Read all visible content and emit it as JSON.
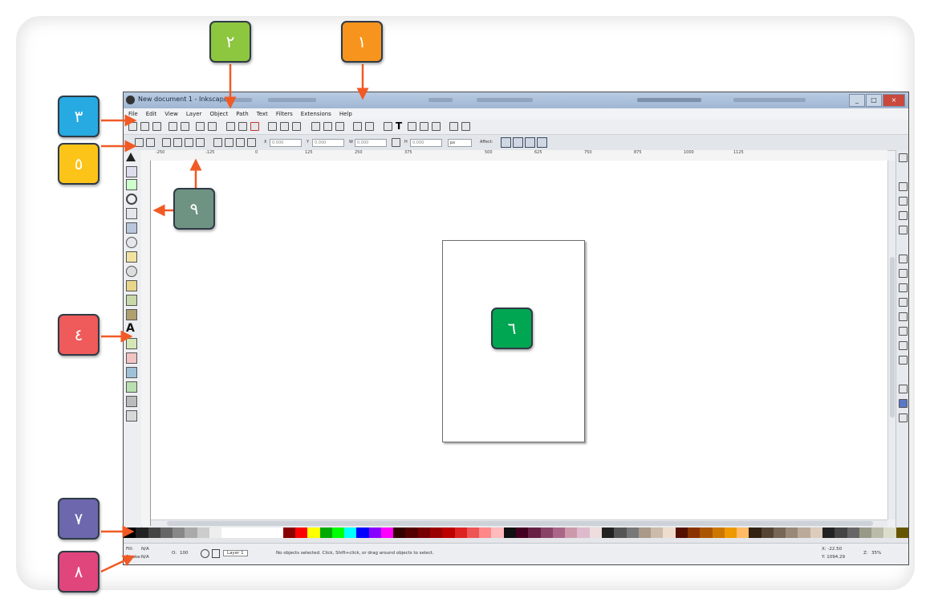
{
  "window": {
    "title": "New document 1 - Inkscape",
    "buttons": [
      "_",
      "□",
      "×"
    ]
  },
  "menu": [
    "File",
    "Edit",
    "View",
    "Layer",
    "Object",
    "Path",
    "Text",
    "Filters",
    "Extensions",
    "Help"
  ],
  "controls": {
    "x_label": "X",
    "x_value": "0.000",
    "y_label": "Y",
    "y_value": "0.000",
    "w_label": "W",
    "w_value": "0.000",
    "h_label": "H",
    "h_value": "0.000",
    "unit": "px",
    "affect_label": "Affect:"
  },
  "ruler": {
    "marks": [
      "-250",
      "-125",
      "0",
      "125",
      "250",
      "375",
      "500",
      "625",
      "750",
      "875",
      "1000",
      "1125"
    ]
  },
  "status": {
    "fill_label": "Fill:",
    "stroke_label": "Stroke:",
    "fill_value": "N/A",
    "stroke_value": "N/A",
    "opacity_label": "O:",
    "opacity_value": "100",
    "layer": "Layer 1",
    "message": "No objects selected. Click, Shift+click, or drag around objects to select.",
    "x_coord": "X: -22.50",
    "y_coord": "Y: 1094.29",
    "zoom_label": "Z:",
    "zoom_value": "35%"
  },
  "callouts": [
    {
      "label": "١",
      "color": "#f7941d"
    },
    {
      "label": "٢",
      "color": "#8dc63f"
    },
    {
      "label": "٣",
      "color": "#27aae1"
    },
    {
      "label": "٤",
      "color": "#ef5a5a"
    },
    {
      "label": "٥",
      "color": "#fcc419"
    },
    {
      "label": "٦",
      "color": "#00a651"
    },
    {
      "label": "٧",
      "color": "#6d67ad"
    },
    {
      "label": "٨",
      "color": "#e0457b"
    },
    {
      "label": "٩",
      "color": "#6f9383"
    }
  ],
  "colors": {
    "arrow": "#f15a24",
    "titlebar": "#a9bfdc",
    "page_border": "#6d6d6d"
  }
}
